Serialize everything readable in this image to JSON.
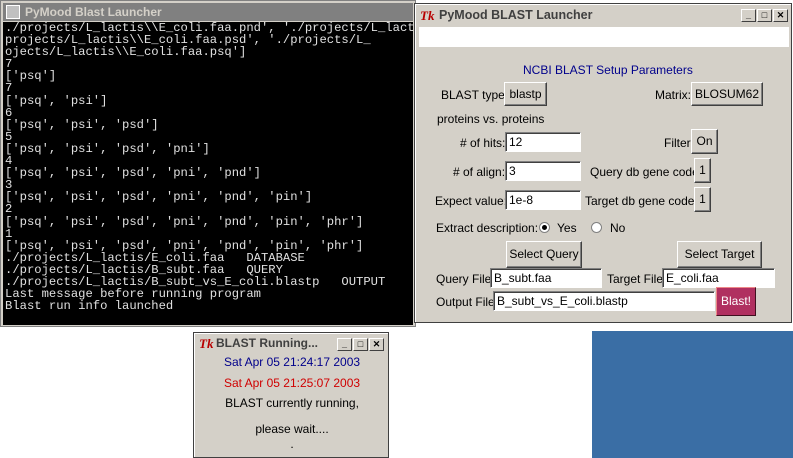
{
  "console": {
    "title": "PyMood Blast Launcher",
    "lines": [
      "./projects/L_lactis\\\\E_coli.faa.pnd', './projects/L_lactis\\\\E_coli.faa.psd', './projects/L_",
      "projects/L_lactis\\\\E_coli.faa.psd', './projects/L_",
      "ojects/L_lactis\\\\E_coli.faa.psq']",
      "7",
      "['psq']",
      "7",
      "['psq', 'psi']",
      "6",
      "['psq', 'psi', 'psd']",
      "5",
      "['psq', 'psi', 'psd', 'pni']",
      "4",
      "['psq', 'psi', 'psd', 'pni', 'pnd']",
      "3",
      "['psq', 'psi', 'psd', 'pni', 'pnd', 'pin']",
      "2",
      "['psq', 'psi', 'psd', 'pni', 'pnd', 'pin', 'phr']",
      "1",
      "['psq', 'psi', 'psd', 'pni', 'pnd', 'pin', 'phr']",
      "./projects/L_lactis/E_coli.faa   DATABASE",
      "./projects/L_lactis/B_subt.faa   QUERY",
      "./projects/L_lactis/B_subt_vs_E_coli.blastp   OUTPUT",
      "Last message before running program",
      "Blast run info launched"
    ]
  },
  "launcher": {
    "tk_logo": "Tk",
    "title": "PyMood BLAST Launcher",
    "min_btn": "_",
    "max_btn": "□",
    "close_btn": "✕",
    "header": "NCBI BLAST Setup Parameters",
    "blast_type_label": "BLAST type:",
    "blast_type_value": "blastp",
    "matrix_label": "Matrix:",
    "matrix_value": "BLOSUM62",
    "mode_text": "proteins vs. proteins",
    "hits_label": "# of hits:",
    "hits_value": "12",
    "filter_label": "Filter:",
    "filter_value": "On",
    "align_label": "# of align:",
    "align_value": "3",
    "query_code_label": "Query db gene code:",
    "query_code_value": "1",
    "expect_label": "Expect value:",
    "expect_value": "1e-8",
    "target_code_label": "Target db gene code:",
    "target_code_value": "1",
    "extract_label": "Extract description:",
    "yes_label": "Yes",
    "no_label": "No",
    "select_query": "Select Query",
    "select_target": "Select Target",
    "query_file_label": "Query File:",
    "query_file_value": "B_subt.faa",
    "target_file_label": "Target File:",
    "target_file_value": "E_coli.faa",
    "output_file_label": "Output File:",
    "output_file_value": "B_subt_vs_E_coli.blastp",
    "blast_button": "Blast!"
  },
  "running": {
    "tk_logo": "Tk",
    "title": "BLAST Running...",
    "start_time": "Sat Apr 05 21:24:17 2003",
    "current_time": "Sat Apr 05 21:25:07 2003",
    "status": "BLAST currently running,",
    "wait": "please wait....",
    "dot": "."
  },
  "colors": {
    "start_time": "#00008b",
    "current_time": "#d00000",
    "blast_button": "#b03060",
    "desktop": "#3a6ea5"
  }
}
